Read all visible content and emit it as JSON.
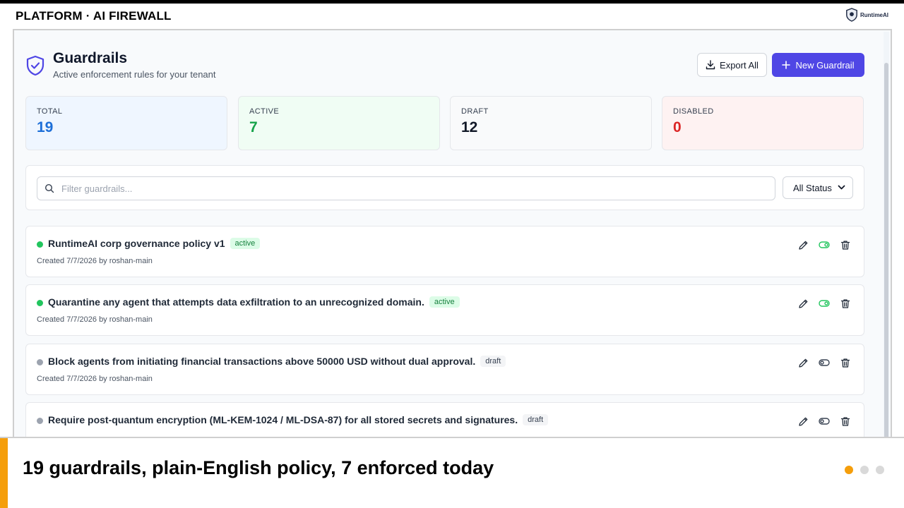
{
  "slide": {
    "label": "PLATFORM · AI FIREWALL",
    "brand": "RuntimeAI",
    "caption": "19 guardrails, plain-English policy, 7 enforced today",
    "pager": {
      "total": 3,
      "current": 1
    }
  },
  "header": {
    "title": "Guardrails",
    "subtitle": "Active enforcement rules for your tenant",
    "export_label": "Export All",
    "new_label": "New Guardrail"
  },
  "stats": [
    {
      "label": "TOTAL",
      "value": "19",
      "color": "#1d6fd8",
      "bg": "#eff6ff"
    },
    {
      "label": "ACTIVE",
      "value": "7",
      "color": "#16a34a",
      "bg": "#f0fdf4"
    },
    {
      "label": "DRAFT",
      "value": "12",
      "color": "#111827",
      "bg": "#f9fafb"
    },
    {
      "label": "DISABLED",
      "value": "0",
      "color": "#dc2626",
      "bg": "#fef2f2"
    }
  ],
  "filter": {
    "placeholder": "Filter guardrails...",
    "value": "",
    "status_selected": "All Status"
  },
  "guardrails": [
    {
      "title": "RuntimeAI corp governance policy v1",
      "status": "active",
      "meta": "Created 7/7/2026 by roshan-main"
    },
    {
      "title": "Quarantine any agent that attempts data exfiltration to an unrecognized domain.",
      "status": "active",
      "meta": "Created 7/7/2026 by roshan-main"
    },
    {
      "title": "Block agents from initiating financial transactions above 50000 USD without dual approval.",
      "status": "draft",
      "meta": "Created 7/7/2026 by roshan-main"
    },
    {
      "title": "Require post-quantum encryption (ML-KEM-1024 / ML-DSA-87) for all stored secrets and signatures.",
      "status": "draft",
      "meta": ""
    }
  ],
  "colors": {
    "accent": "#4f46e5",
    "active_dot": "#22c55e",
    "draft_dot": "#9ca3af",
    "caption_bar": "#f59e0b"
  },
  "icons": [
    "shield-check-icon",
    "download-icon",
    "plus-icon",
    "search-icon",
    "chevron-down-icon",
    "edit-icon",
    "toggle-icon",
    "trash-icon"
  ]
}
